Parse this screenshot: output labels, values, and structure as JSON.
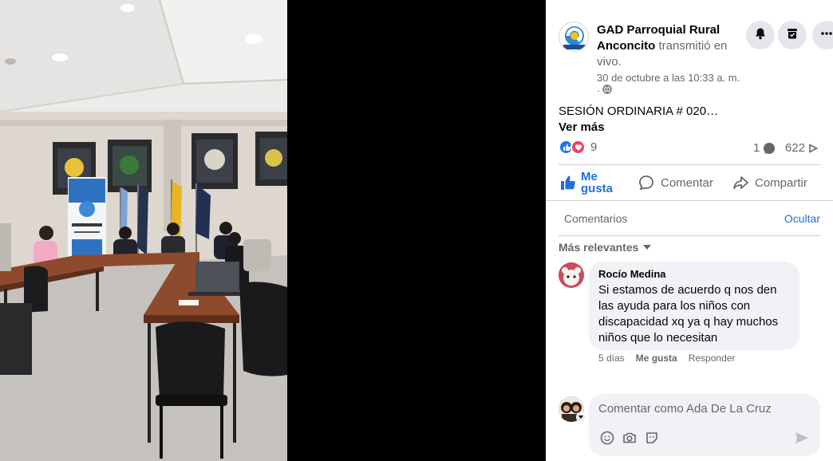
{
  "post": {
    "page_name": "GAD Parroquial Rural Anconcito",
    "action_text": "transmitió en vivo.",
    "date": "30 de octubre a las 10:33 a. m.",
    "privacy_prefix": "·",
    "title": "SESIÓN ORDINARIA # 020…",
    "see_more": "Ver más",
    "reaction_count": "9",
    "comment_count": "1",
    "view_count": "622",
    "logo_text": "ANCONCITO"
  },
  "actions": {
    "like": "Me gusta",
    "comment": "Comentar",
    "share": "Compartir"
  },
  "comments_section": {
    "header": "Comentarios",
    "hide": "Ocultar",
    "sort": "Más relevantes",
    "comments": [
      {
        "author": "Rocío Medina",
        "text": "Si estamos de acuerdo q nos den las ayuda para los niños con discapacidad xq ya q hay muchos niños que lo necesitan",
        "time": "5 días",
        "like": "Me gusta",
        "reply": "Responder"
      }
    ],
    "composer_placeholder": "Comentar como Ada De La Cruz"
  },
  "icons": {
    "notify": "bell-icon",
    "save": "bookmark-icon",
    "more": "more-icon",
    "privacy": "globe-icon",
    "views": "play-icon"
  },
  "colors": {
    "link": "#216fdb",
    "like_blue": "#1877f2",
    "love_red": "#f33e58",
    "bubble": "#f0f2f5"
  }
}
